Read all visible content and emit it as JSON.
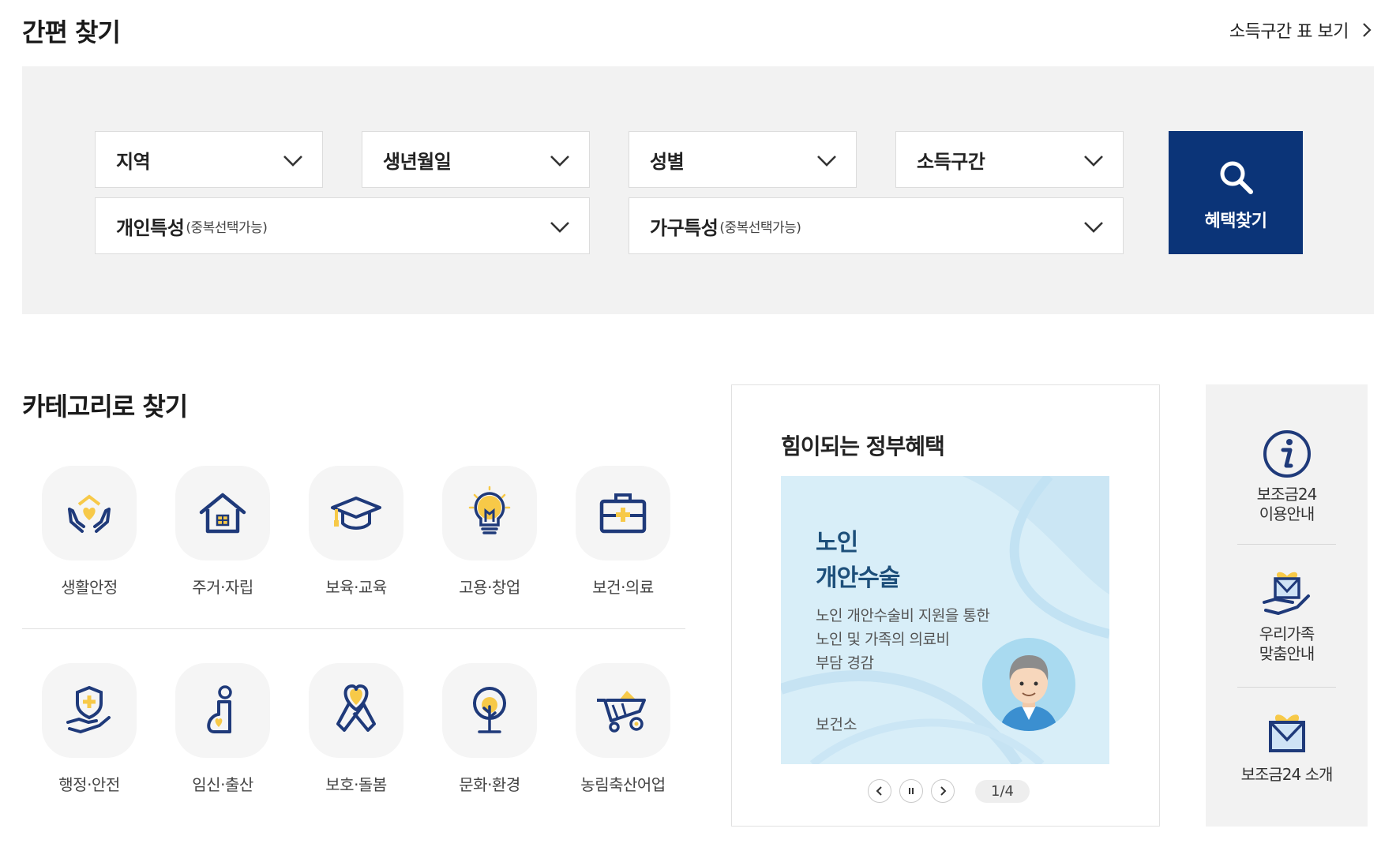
{
  "header": {
    "title": "간편 찾기",
    "income_table_link": "소득구간 표 보기"
  },
  "search": {
    "region": "지역",
    "birthdate": "생년월일",
    "gender": "성별",
    "income": "소득구간",
    "personal": "개인특성",
    "personal_sub": "(중복선택가능)",
    "household": "가구특성",
    "household_sub": "(중복선택가능)",
    "button_label": "혜택찾기"
  },
  "categories": {
    "title": "카테고리로 찾기",
    "items": [
      {
        "label": "생활안정",
        "icon": "hands-heart-icon"
      },
      {
        "label": "주거·자립",
        "icon": "house-icon"
      },
      {
        "label": "보육·교육",
        "icon": "graduation-cap-icon"
      },
      {
        "label": "고용·창업",
        "icon": "lightbulb-icon"
      },
      {
        "label": "보건·의료",
        "icon": "medical-kit-icon"
      },
      {
        "label": "행정·안전",
        "icon": "shield-hand-icon"
      },
      {
        "label": "임신·출산",
        "icon": "pregnancy-icon"
      },
      {
        "label": "보호·돌봄",
        "icon": "ribbon-heart-icon"
      },
      {
        "label": "문화·환경",
        "icon": "tree-icon"
      },
      {
        "label": "농림축산어업",
        "icon": "wheelbarrow-icon"
      }
    ]
  },
  "benefit": {
    "title": "힘이되는 정부혜택",
    "banner": {
      "headline_1": "노인",
      "headline_2": "개안수술",
      "desc_1": "노인 개안수술비 지원을 통한",
      "desc_2": "노인 및 가족의 의료비",
      "desc_3": "부담 경감",
      "org": "보건소"
    },
    "pager": "1/4"
  },
  "side": {
    "items": [
      {
        "line1": "보조금24",
        "line2": "이용안내"
      },
      {
        "line1": "우리가족",
        "line2": "맞춤안내"
      },
      {
        "line1": "보조금24 소개",
        "line2": ""
      }
    ]
  },
  "colors": {
    "primary_navy": "#0b3478",
    "icon_navy": "#1f3a7a",
    "icon_yellow": "#f7c948",
    "banner_bg": "#d8eef8"
  }
}
